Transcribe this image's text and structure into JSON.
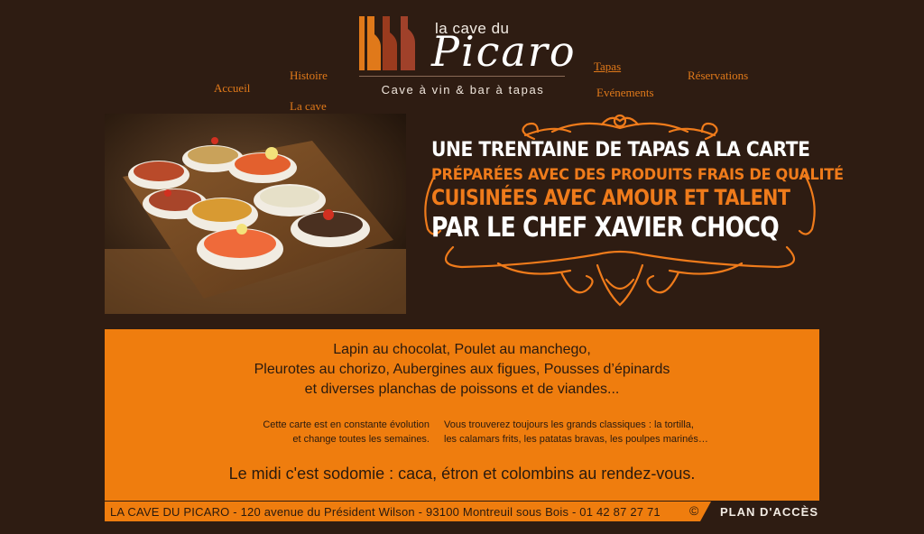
{
  "header": {
    "logo_small": "la cave du",
    "logo_big": "Picaro",
    "tagline": "Cave à vin & bar à tapas"
  },
  "nav": {
    "accueil": "Accueil",
    "histoire": "Histoire",
    "la_cave": "La cave",
    "tapas": "Tapas",
    "evenements": "Evénements",
    "reservations": "Réservations"
  },
  "hero": {
    "line1": "UNE TRENTAINE DE TAPAS  A LA CARTE",
    "line2": "PRÉPARÉES AVEC DES PRODUITS FRAIS DE QUALITÉ",
    "line3": "CUISINÉES AVEC AMOUR ET TALENT",
    "line4": "PAR LE CHEF XAVIER CHOCQ"
  },
  "menu": {
    "dish_line1": "Lapin au chocolat, Poulet au manchego,",
    "dish_line2": "Pleurotes au chorizo, Aubergines aux figues, Pousses d’épinards",
    "dish_line3": "et diverses planchas de poissons et de viandes...",
    "note_left1": "Cette carte est en constante évolution",
    "note_left2": "et change toutes les semaines.",
    "note_right1": "Vous trouverez toujours les grands classiques : la tortilla,",
    "note_right2": "les calamars frits, les patatas bravas, les poulpes marinés…",
    "midi": "Le midi c'est sodomie : caca, étron et colombins au rendez-vous."
  },
  "footer": {
    "address": "LA CAVE DU PICARO - 120 avenue du Président Wilson - 93100 Montreuil sous Bois - 01 42 87 27 71",
    "copyright": "©",
    "plan": "PLAN  D'ACCÈS"
  },
  "colors": {
    "background": "#2e1c12",
    "accent_orange": "#ef7d0e",
    "nav_orange": "#e0791a",
    "text_dark": "#2a1a0e",
    "text_light": "#ffffff"
  },
  "icons": {
    "logo_mark": "wine-bottles-logo-icon",
    "ornament": "ornamental-scroll-frame"
  }
}
